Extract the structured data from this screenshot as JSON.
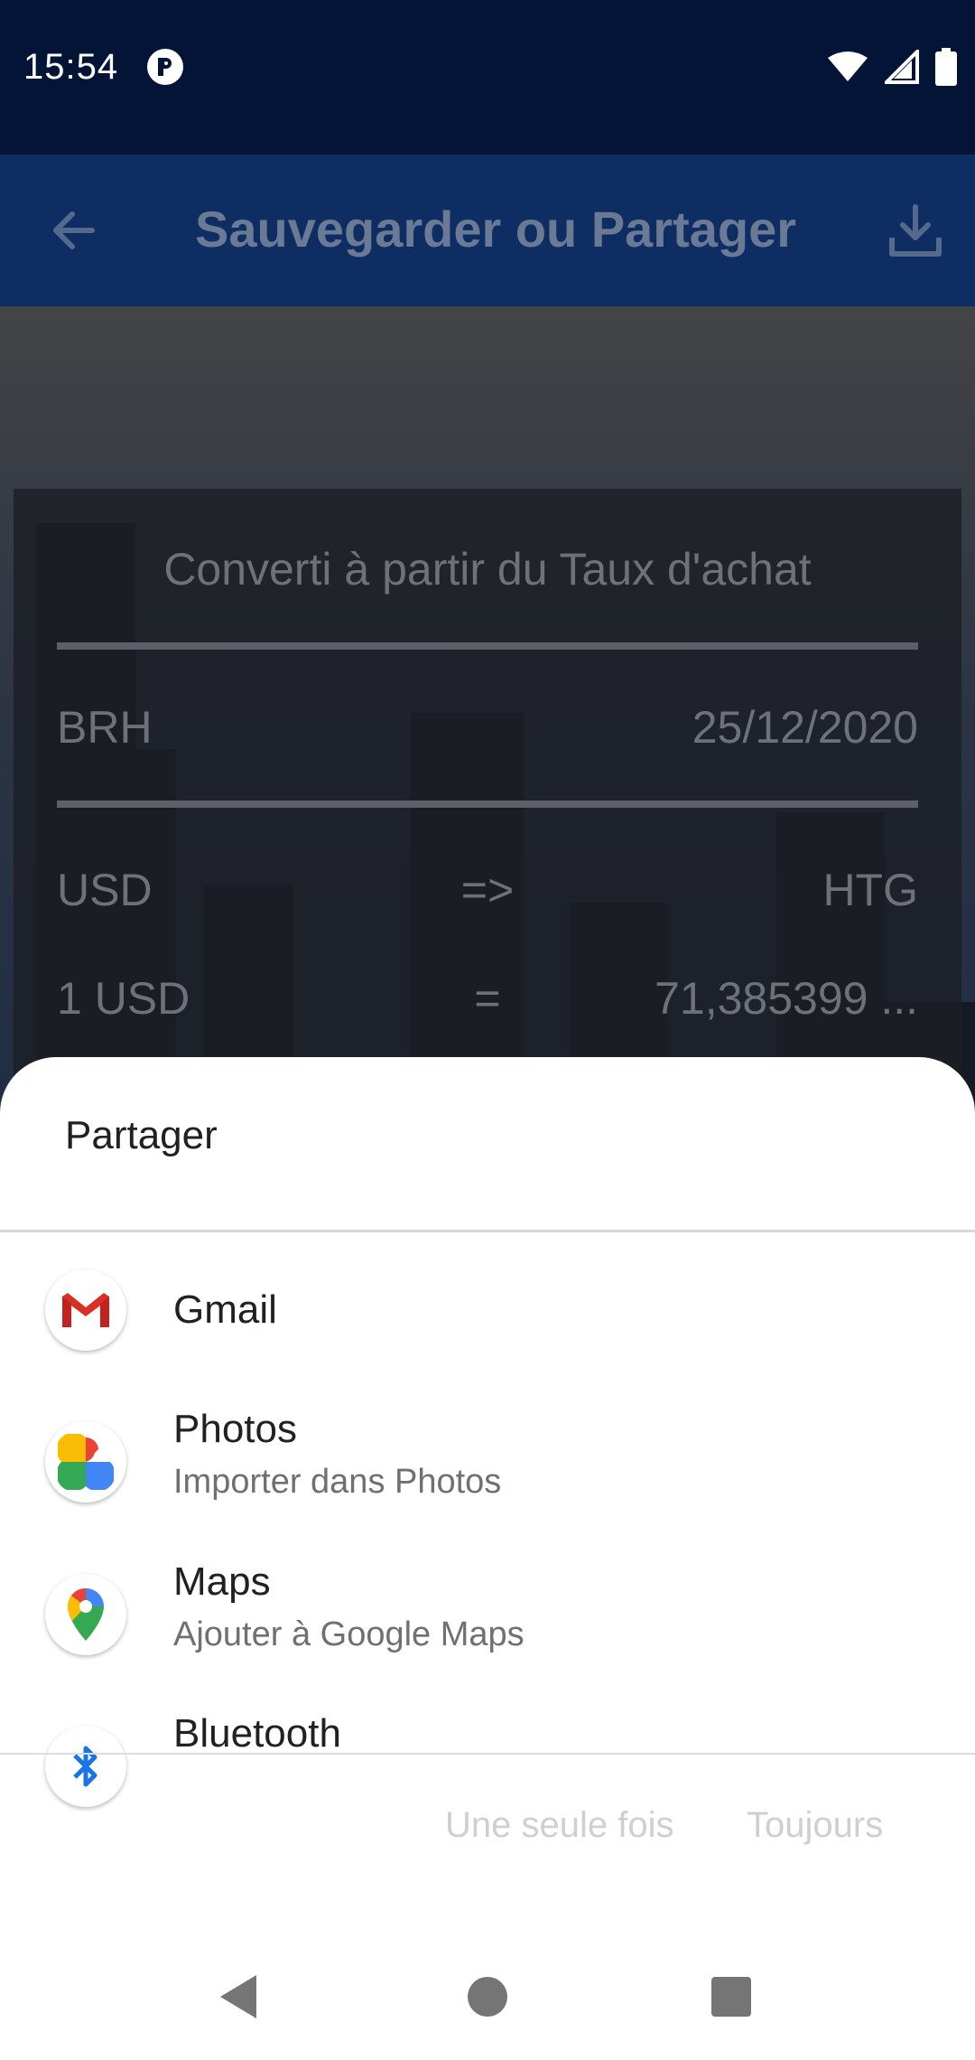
{
  "status_bar": {
    "time": "15:54",
    "icons": [
      "app-notification-icon",
      "wifi-icon",
      "signal-icon",
      "battery-icon"
    ]
  },
  "app_bar": {
    "title": "Sauvegarder ou Partager",
    "back_icon": "arrow-back-icon",
    "download_icon": "download-icon",
    "color": "#0e2d63"
  },
  "card": {
    "subtitle": "Converti à partir du Taux d'achat",
    "rows": [
      {
        "left": "BRH",
        "center": "",
        "right": "25/12/2020"
      },
      {
        "left": "USD",
        "center": "=>",
        "right": "HTG"
      },
      {
        "left": "1 USD",
        "center": "=",
        "right": "71,385399 ..."
      }
    ]
  },
  "share_sheet": {
    "title": "Partager",
    "apps": [
      {
        "name": "Gmail",
        "subtitle": "",
        "icon": "gmail-icon"
      },
      {
        "name": "Photos",
        "subtitle": "Importer dans Photos",
        "icon": "google-photos-icon"
      },
      {
        "name": "Maps",
        "subtitle": "Ajouter à Google Maps",
        "icon": "google-maps-icon"
      },
      {
        "name": "Bluetooth",
        "subtitle": "",
        "icon": "bluetooth-icon"
      }
    ],
    "actions": {
      "once": "Une seule fois",
      "always": "Toujours"
    }
  },
  "nav_bar": {
    "icons": [
      "back-triangle-icon",
      "home-circle-icon",
      "recents-square-icon"
    ]
  }
}
